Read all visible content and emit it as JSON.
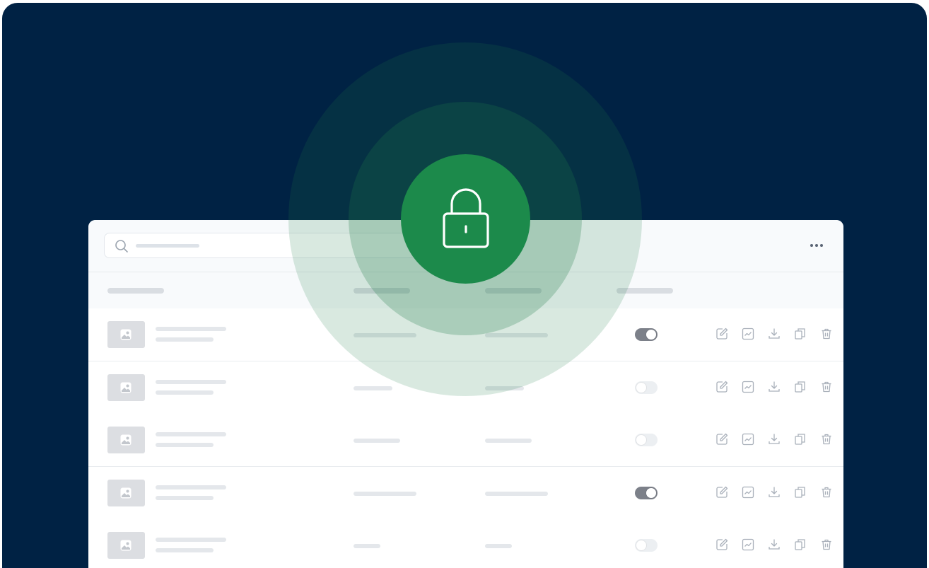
{
  "colors": {
    "background": "#002244",
    "accent": "#1c8a4b",
    "panel": "#ffffff",
    "placeholder": "#e4e7eb",
    "toggle_on": "#7c8089",
    "toggle_off": "#eceff2"
  },
  "toolbar": {
    "search_icon": "search-icon",
    "more_icon": "more-horizontal-icon"
  },
  "overlay": {
    "icon": "lock-icon"
  },
  "table": {
    "row_icons": [
      "image-icon",
      "edit-icon",
      "chart-icon",
      "download-icon",
      "copy-icon",
      "trash-icon"
    ],
    "rows": [
      {
        "toggle_on": true
      },
      {
        "toggle_on": false
      },
      {
        "toggle_on": false
      },
      {
        "toggle_on": true
      },
      {
        "toggle_on": false
      }
    ]
  }
}
